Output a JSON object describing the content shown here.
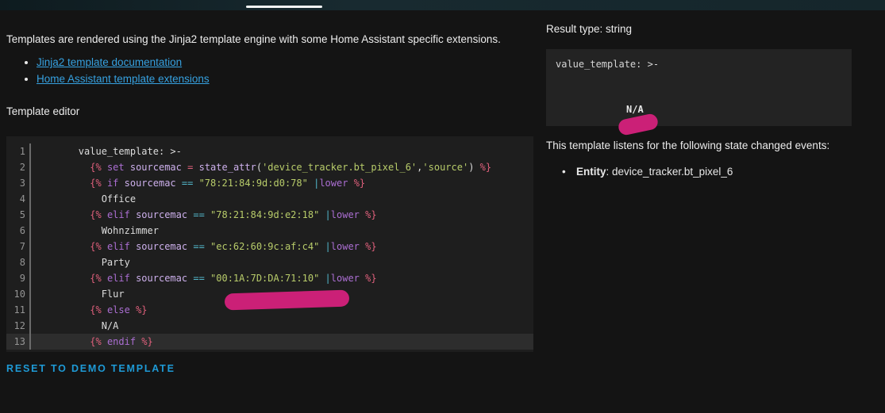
{
  "colors": {
    "accent": "#1e9ad6",
    "link": "#36a1e0",
    "pink": "#e0607c",
    "purple": "#ab6ed2",
    "lav": "#cdb0ec",
    "cyan": "#52b5c9",
    "green": "#b8cc6a",
    "marker": "#cb2077"
  },
  "intro": {
    "text": "Templates are rendered using the Jinja2 template engine with some Home Assistant specific extensions.",
    "links": [
      {
        "label": "Jinja2 template documentation"
      },
      {
        "label": "Home Assistant template extensions"
      }
    ]
  },
  "editor": {
    "label": "Template editor",
    "reset_label": "RESET TO DEMO TEMPLATE",
    "active_line": 13,
    "lines": [
      {
        "n": 1,
        "tokens": [
          [
            "        value_template: >-",
            "plain"
          ]
        ]
      },
      {
        "n": 2,
        "tokens": [
          [
            "          ",
            "plain"
          ],
          [
            "{%",
            "pink"
          ],
          [
            " ",
            "plain"
          ],
          [
            "set",
            "purple"
          ],
          [
            " ",
            "plain"
          ],
          [
            "sourcemac",
            "lav"
          ],
          [
            " ",
            "plain"
          ],
          [
            "=",
            "pink"
          ],
          [
            " ",
            "plain"
          ],
          [
            "state_attr",
            "lav"
          ],
          [
            "(",
            "plain"
          ],
          [
            "'device_tracker.bt_pixel_6'",
            "green"
          ],
          [
            ",",
            "plain"
          ],
          [
            "'source'",
            "green"
          ],
          [
            ") ",
            "plain"
          ],
          [
            "%}",
            "pink"
          ]
        ]
      },
      {
        "n": 3,
        "tokens": [
          [
            "          ",
            "plain"
          ],
          [
            "{%",
            "pink"
          ],
          [
            " ",
            "plain"
          ],
          [
            "if",
            "purple"
          ],
          [
            " ",
            "plain"
          ],
          [
            "sourcemac",
            "lav"
          ],
          [
            " ",
            "plain"
          ],
          [
            "==",
            "cyan"
          ],
          [
            " ",
            "plain"
          ],
          [
            "\"78:21:84:9d:d0:78\"",
            "green"
          ],
          [
            " ",
            "plain"
          ],
          [
            "|",
            "cyan"
          ],
          [
            "lower",
            "purple"
          ],
          [
            " ",
            "plain"
          ],
          [
            "%}",
            "pink"
          ]
        ]
      },
      {
        "n": 4,
        "tokens": [
          [
            "            Office",
            "plain"
          ]
        ]
      },
      {
        "n": 5,
        "tokens": [
          [
            "          ",
            "plain"
          ],
          [
            "{%",
            "pink"
          ],
          [
            " ",
            "plain"
          ],
          [
            "elif",
            "purple"
          ],
          [
            " ",
            "plain"
          ],
          [
            "sourcemac",
            "lav"
          ],
          [
            " ",
            "plain"
          ],
          [
            "==",
            "cyan"
          ],
          [
            " ",
            "plain"
          ],
          [
            "\"78:21:84:9d:e2:18\"",
            "green"
          ],
          [
            " ",
            "plain"
          ],
          [
            "|",
            "cyan"
          ],
          [
            "lower",
            "purple"
          ],
          [
            " ",
            "plain"
          ],
          [
            "%}",
            "pink"
          ]
        ]
      },
      {
        "n": 6,
        "tokens": [
          [
            "            Wohnzimmer",
            "plain"
          ]
        ]
      },
      {
        "n": 7,
        "tokens": [
          [
            "          ",
            "plain"
          ],
          [
            "{%",
            "pink"
          ],
          [
            " ",
            "plain"
          ],
          [
            "elif",
            "purple"
          ],
          [
            " ",
            "plain"
          ],
          [
            "sourcemac",
            "lav"
          ],
          [
            " ",
            "plain"
          ],
          [
            "==",
            "cyan"
          ],
          [
            " ",
            "plain"
          ],
          [
            "\"ec:62:60:9c:af:c4\"",
            "green"
          ],
          [
            " ",
            "plain"
          ],
          [
            "|",
            "cyan"
          ],
          [
            "lower",
            "purple"
          ],
          [
            " ",
            "plain"
          ],
          [
            "%}",
            "pink"
          ]
        ]
      },
      {
        "n": 8,
        "tokens": [
          [
            "            Party",
            "plain"
          ]
        ]
      },
      {
        "n": 9,
        "tokens": [
          [
            "          ",
            "plain"
          ],
          [
            "{%",
            "pink"
          ],
          [
            " ",
            "plain"
          ],
          [
            "elif",
            "purple"
          ],
          [
            " ",
            "plain"
          ],
          [
            "sourcemac",
            "lav"
          ],
          [
            " ",
            "plain"
          ],
          [
            "==",
            "cyan"
          ],
          [
            " ",
            "plain"
          ],
          [
            "\"00:1A:7D:DA:71:10\"",
            "green"
          ],
          [
            " ",
            "plain"
          ],
          [
            "|",
            "cyan"
          ],
          [
            "lower",
            "purple"
          ],
          [
            " ",
            "plain"
          ],
          [
            "%}",
            "pink"
          ]
        ]
      },
      {
        "n": 10,
        "tokens": [
          [
            "            Flur",
            "plain"
          ]
        ]
      },
      {
        "n": 11,
        "tokens": [
          [
            "          ",
            "plain"
          ],
          [
            "{%",
            "pink"
          ],
          [
            " ",
            "plain"
          ],
          [
            "else",
            "purple"
          ],
          [
            " ",
            "plain"
          ],
          [
            "%}",
            "pink"
          ]
        ]
      },
      {
        "n": 12,
        "tokens": [
          [
            "            N/A",
            "plain"
          ]
        ]
      },
      {
        "n": 13,
        "tokens": [
          [
            "          ",
            "plain"
          ],
          [
            "{%",
            "pink"
          ],
          [
            " ",
            "plain"
          ],
          [
            "endif",
            "purple"
          ],
          [
            " ",
            "plain"
          ],
          [
            "%}",
            "pink"
          ]
        ]
      }
    ]
  },
  "result": {
    "type_label": "Result type: string",
    "output_line": "value_template: >-",
    "output_value": "N/A",
    "listens_text": "This template listens for the following state changed events:",
    "entity_label": "Entity",
    "separator": ": ",
    "entity_value": "device_tracker.bt_pixel_6"
  }
}
